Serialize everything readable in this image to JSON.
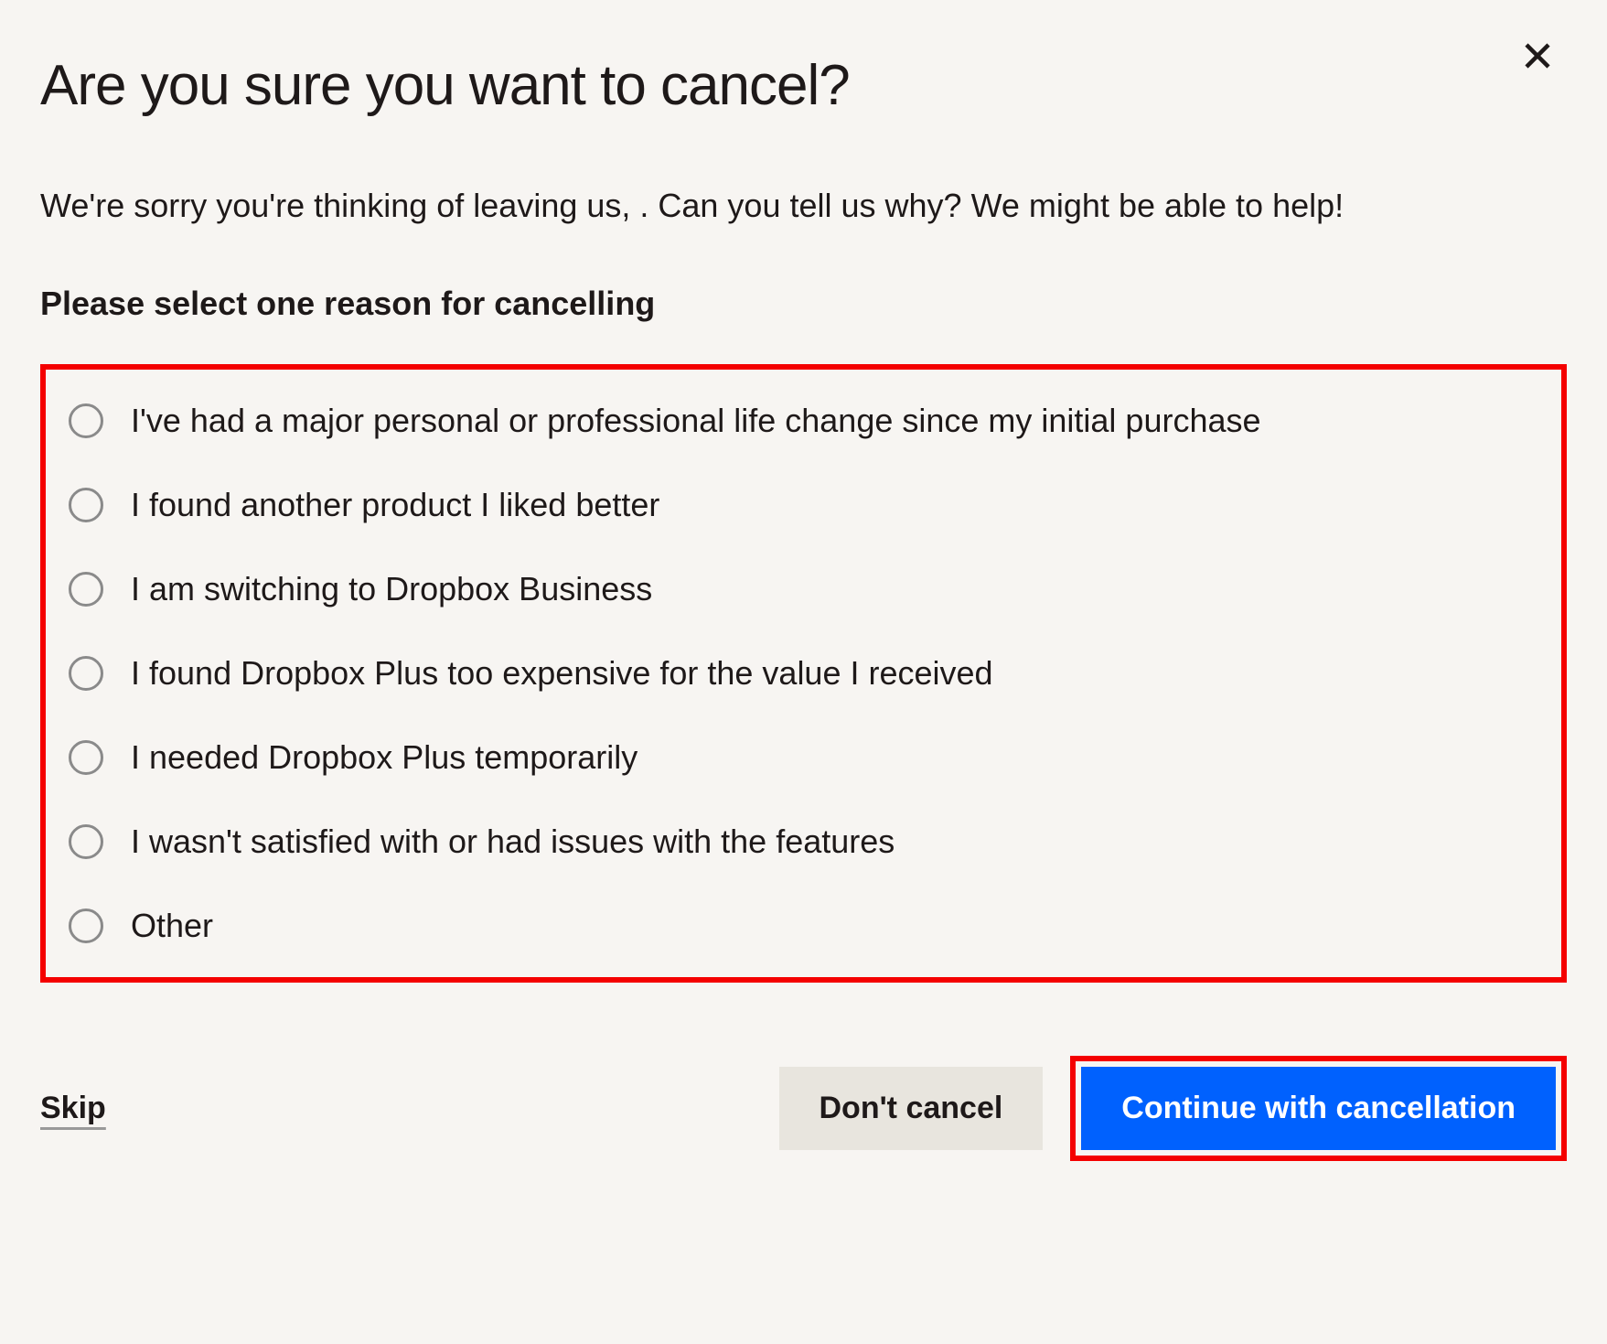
{
  "title": "Are you sure you want to cancel?",
  "subtitle": "We're sorry you're thinking of leaving us,           . Can you tell us why? We might be able to help!",
  "prompt_label": "Please select one reason for cancelling",
  "reasons": [
    "I've had a major personal or professional life change since my initial purchase",
    "I found another product I liked better",
    "I am switching to Dropbox Business",
    "I found Dropbox Plus too expensive for the value I received",
    "I needed Dropbox Plus temporarily",
    "I wasn't satisfied with or had issues with the features",
    "Other"
  ],
  "footer": {
    "skip_label": "Skip",
    "dont_cancel_label": "Don't cancel",
    "continue_label": "Continue with cancellation"
  }
}
